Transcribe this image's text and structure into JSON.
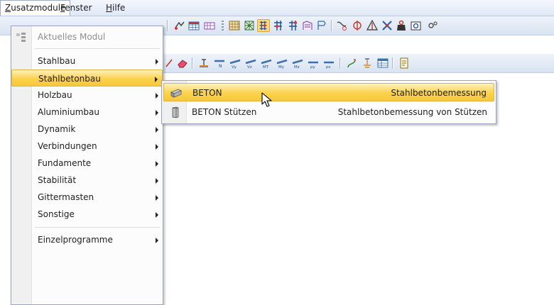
{
  "menubar": {
    "items": [
      {
        "label_pre": "",
        "label_ul": "Z",
        "label_post": "usatzmodule"
      },
      {
        "label_pre": "",
        "label_ul": "F",
        "label_post": "enster"
      },
      {
        "label_pre": "",
        "label_ul": "H",
        "label_post": "ilfe"
      }
    ]
  },
  "menu": {
    "items": [
      {
        "label": "Aktuelles Modul"
      },
      {
        "label": "Stahlbau"
      },
      {
        "label": "Stahlbetonbau"
      },
      {
        "label": "Holzbau"
      },
      {
        "label": "Aluminiumbau"
      },
      {
        "label": "Dynamik"
      },
      {
        "label": "Verbindungen"
      },
      {
        "label": "Fundamente"
      },
      {
        "label": "Stabilität"
      },
      {
        "label": "Gittermasten"
      },
      {
        "label": "Sonstige"
      },
      {
        "label": "Einzelprogramme"
      }
    ]
  },
  "submenu": {
    "items": [
      {
        "label": "BETON",
        "desc": "Stahlbetonbemessung"
      },
      {
        "label": "BETON Stützen",
        "desc": "Stahlbetonbemessung von Stützen"
      }
    ]
  },
  "icons": {
    "toolbar1": [
      "model-view-icon",
      "table-icon",
      "results-icon",
      "grid-icon",
      "mesh-icon",
      "member-select-icon",
      "node-icon",
      "support-icon",
      "section-icon",
      "hinge-icon",
      "curve-icon",
      "release-icon",
      "triangle-load-icon",
      "cross-icon",
      "weight-icon",
      "camera-icon",
      "settings-icon"
    ],
    "toolbar2": [
      "arrow-icon",
      "eraser-icon",
      "bar-n-icon",
      "bar-vy-icon",
      "bar-vz-icon",
      "bar-mt-icon",
      "bar-my-icon",
      "bar-mz-icon",
      "bar-py-icon",
      "bar-pz-icon",
      "deform-icon",
      "member-icon",
      "table-view-icon",
      "report-icon"
    ]
  },
  "colors": {
    "highlight_top": "#fdf1c0",
    "highlight_bottom": "#f9c73a",
    "highlight_border": "#e3b23c",
    "menu_border": "#97a6bf"
  }
}
